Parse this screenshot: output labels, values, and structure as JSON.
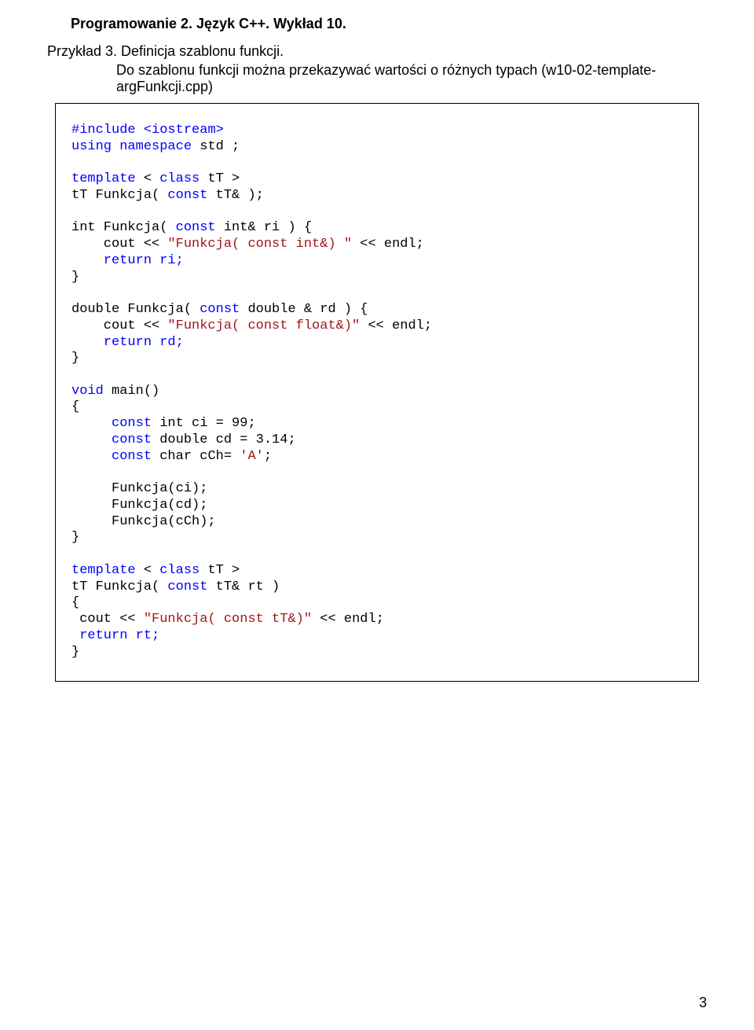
{
  "header": "Programowanie 2. Język C++. Wykład 10.",
  "example_label_prefix": "Przykład 3.  ",
  "example_label_text": "Definicja szablonu funkcji.",
  "example_desc": "Do szablonu funkcji można przekazywać wartości o różnych typach  (w10-02-template-argFunkcji.cpp)",
  "page_number": "3",
  "code": {
    "t": {
      "include": "#include ",
      "iostream": "<iostream>",
      "using": "using",
      "namespace": "namespace",
      "std_semi": " std ;",
      "template": "template",
      "lt": " < ",
      "class": "class",
      "tT_gt": " tT >",
      "tT_funkcja": "tT Funkcja( ",
      "const": "const",
      "tT_amp_close": " tT& );",
      "int_funkcja": "int Funkcja( ",
      "int_amp_ri": " int& ri ) {",
      "cout_indent": "    cout << ",
      "s_funkcja_int": "\"Funkcja( const int&) \"",
      "lt_endl": " << endl;",
      "return_ri": "    return ri;",
      "rbrace": "}",
      "double_funkcja": "double Funkcja( ",
      "double_rd": " double & rd ) {",
      "s_funkcja_float": "\"Funkcja( const float&)\"",
      "return_rd": "    return rd;",
      "void": "void",
      "main_paren": " main()",
      "lbrace": "{",
      "ci_pre": "     ",
      "int_ci": " int ci = 99;",
      "double_cd": " double cd = 3.14;",
      "char_cch": " char cCh= ",
      "char_A": "'A'",
      "semi": ";",
      "funkcja_ci": "     Funkcja(ci);",
      "funkcja_cd": "     Funkcja(cd);",
      "funkcja_cch": "     Funkcja(cCh);",
      "tT_rt": " tT& rt )",
      "cout1": " cout << ",
      "s_funkcja_tt": "\"Funkcja( const tT&)\"",
      "return_rt": " return rt;"
    }
  }
}
